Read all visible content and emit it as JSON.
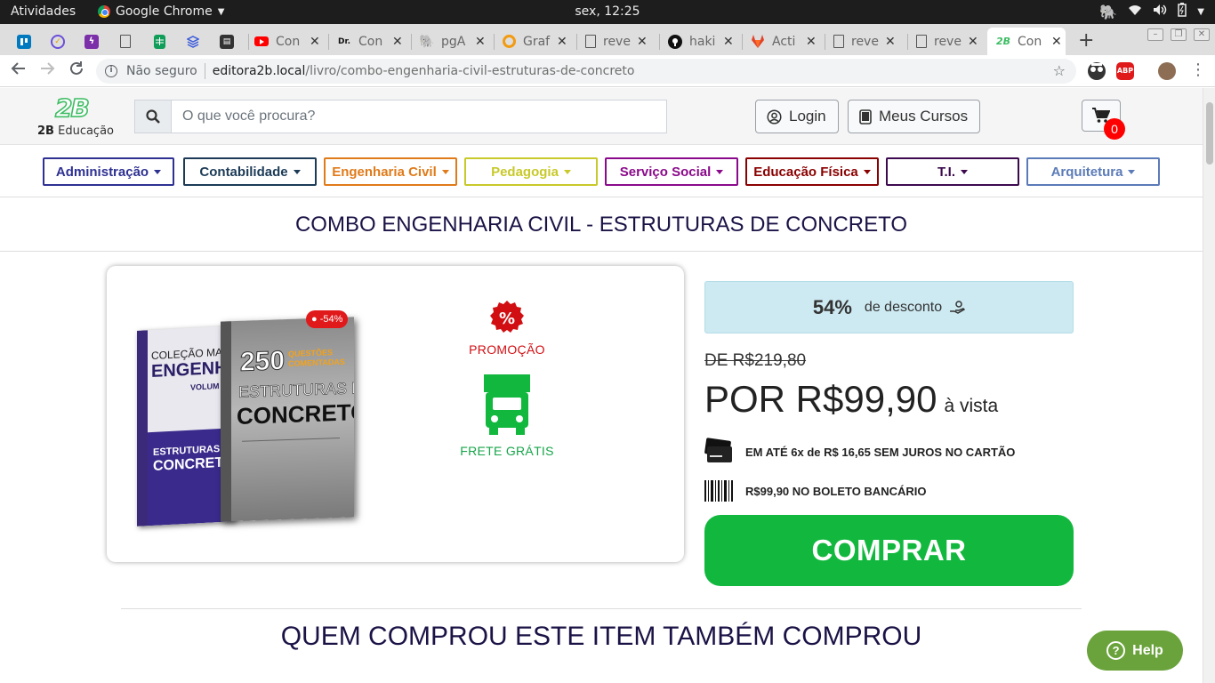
{
  "os_topbar": {
    "activities": "Atividades",
    "app_name": "Google Chrome",
    "clock": "sex, 12:25"
  },
  "tabs": {
    "items": [
      {
        "label": "Con",
        "icon": "youtube-icon"
      },
      {
        "label": "Con",
        "icon": "dr-icon"
      },
      {
        "label": "pgA",
        "icon": "postgres-icon"
      },
      {
        "label": "Graf",
        "icon": "grafana-icon"
      },
      {
        "label": "reve",
        "icon": "document-icon"
      },
      {
        "label": "haki",
        "icon": "github-icon"
      },
      {
        "label": "Acti",
        "icon": "gitlab-icon"
      },
      {
        "label": "reve",
        "icon": "document-icon"
      },
      {
        "label": "reve",
        "icon": "document-icon"
      },
      {
        "label": "Con",
        "icon": "2b-icon"
      }
    ],
    "new_tab": "+"
  },
  "omnibox": {
    "security_label": "Não seguro",
    "host": "editora2b.local",
    "path": "/livro/combo-engenharia-civil-estruturas-de-concreto"
  },
  "extensions": {
    "abp": "ABP"
  },
  "header": {
    "logo_mark": "2B",
    "logo_brand": "2B",
    "logo_sub": "Educação",
    "search_placeholder": "O que você procura?",
    "login_label": "Login",
    "courses_label": "Meus Cursos",
    "cart_count": "0"
  },
  "categories": [
    {
      "label": "Administração",
      "color": "#2e3192"
    },
    {
      "label": "Contabilidade",
      "color": "#1c3b57"
    },
    {
      "label": "Engenharia Civil",
      "color": "#e07b1a"
    },
    {
      "label": "Pedagogia",
      "color": "#c8c92a"
    },
    {
      "label": "Serviço Social",
      "color": "#8b0a8b"
    },
    {
      "label": "Educação Física",
      "color": "#8b0000"
    },
    {
      "label": "T.I.",
      "color": "#3d0a4f"
    },
    {
      "label": "Arquitetura",
      "color": "#5b7bb8"
    }
  ],
  "product": {
    "title": "COMBO ENGENHARIA CIVIL - ESTRUTURAS DE CONCRETO",
    "book_badge": "-54%",
    "book1": {
      "title_top": "COLEÇÃO MA",
      "title_main": "ENGENHAR",
      "vol": "VOLUM",
      "subtitle": "ESTRUTURAS D",
      "subtitle2": "CONCRET"
    },
    "book2": {
      "number": "250",
      "questions": "QUESTÕES COMENTADAS",
      "title1": "ESTRUTURAS DE",
      "title2": "CONCRETO"
    },
    "promo_label": "PROMOÇÃO",
    "freight_label": "FRETE GRÁTIS"
  },
  "pricing": {
    "discount_pct": "54%",
    "discount_text": "de desconto",
    "old_price": "DE R$219,80",
    "new_price": "POR R$99,90",
    "vista": "à vista",
    "card_installments": "EM ATÉ 6x de R$ 16,65 SEM JUROS NO CARTÃO",
    "boleto": "R$99,90 NO BOLETO BANCÁRIO",
    "buy_label": "COMPRAR"
  },
  "related_title": "QUEM COMPROU ESTE ITEM TAMBÉM COMPROU",
  "help_label": "Help",
  "colors": {
    "buy": "#12b83e",
    "promo": "#d10e12",
    "freight": "#17a44a",
    "discount_bg": "#cde9f1",
    "help": "#6aa33b"
  }
}
